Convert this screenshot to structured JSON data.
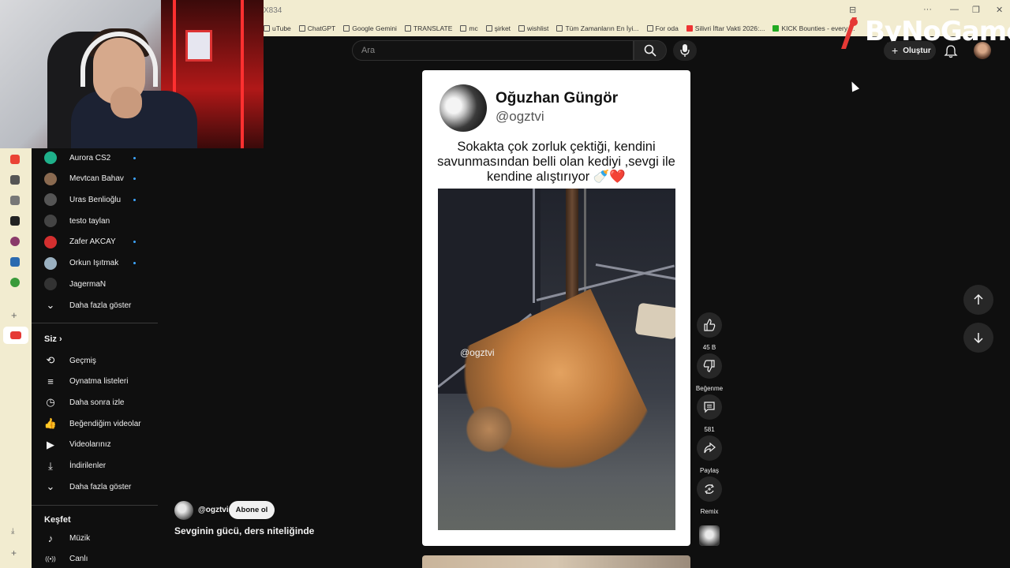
{
  "browser": {
    "tab_title": "X834",
    "bookmarks": [
      {
        "label": "uTube",
        "icon": "youtube-icon"
      },
      {
        "label": "ChatGPT",
        "icon": "chatgpt-icon"
      },
      {
        "label": "Google Gemini",
        "icon": "gemini-icon"
      },
      {
        "label": "TRANSLATE",
        "icon": "translate-icon"
      },
      {
        "label": "mc",
        "icon": "folder-icon"
      },
      {
        "label": "şirket",
        "icon": "folder-icon"
      },
      {
        "label": "wishlist",
        "icon": "folder-icon"
      },
      {
        "label": "Tüm Zamanların En İyi...",
        "icon": "page-icon"
      },
      {
        "label": "For oda",
        "icon": "folder-icon"
      },
      {
        "label": "Silivri İftar Vakti 2026:...",
        "icon": "page-icon"
      },
      {
        "label": "KICK Bounties - every ...",
        "icon": "kick-icon"
      }
    ]
  },
  "overlay": {
    "brand": "ByNoGame"
  },
  "header": {
    "search_placeholder": "Ara",
    "create_label": "Oluştur"
  },
  "sidebar": {
    "subscriptions": [
      {
        "label": "Aurora CS2",
        "new": true,
        "color": "#1fb08a"
      },
      {
        "label": "Mevtcan Bahav",
        "new": true,
        "color": "#8a6a50"
      },
      {
        "label": "Uras Benlioğlu",
        "new": true,
        "color": "#555555"
      },
      {
        "label": "testo taylan",
        "new": false,
        "color": "#444444"
      },
      {
        "label": "Zafer AKCAY",
        "new": true,
        "color": "#d32f2f"
      },
      {
        "label": "Orkun Işıtmak",
        "new": true,
        "color": "#9ab0c0"
      },
      {
        "label": "JagermaN",
        "new": false,
        "color": "#333333"
      }
    ],
    "show_more_1": "Daha fazla göster",
    "you_heading": "Siz",
    "you_items": [
      {
        "label": "Geçmiş",
        "icon": "history-icon"
      },
      {
        "label": "Oynatma listeleri",
        "icon": "playlists-icon"
      },
      {
        "label": "Daha sonra izle",
        "icon": "watch-later-icon"
      },
      {
        "label": "Beğendiğim videolar",
        "icon": "liked-videos-icon"
      },
      {
        "label": "Videolarınız",
        "icon": "your-videos-icon"
      },
      {
        "label": "İndirilenler",
        "icon": "downloads-icon"
      }
    ],
    "show_more_2": "Daha fazla göster",
    "explore_heading": "Keşfet",
    "explore_items": [
      {
        "label": "Müzik",
        "icon": "music-icon"
      },
      {
        "label": "Canlı",
        "icon": "live-icon"
      }
    ]
  },
  "short": {
    "tweet_name": "Oğuzhan Güngör",
    "tweet_handle": "@ogztvi",
    "tweet_text": "Sokakta çok zorluk çektiği, kendini savunmasından belli olan kediyi ,sevgi ile kendine alıştırıyor 🍼❤️",
    "watermark": "@ogztvi",
    "channel": "@ogztvi",
    "subscribe_label": "Abone ol",
    "title": "Sevginin gücü, ders niteliğinde"
  },
  "actions": {
    "like_count": "45 B",
    "dislike_label": "Beğenme",
    "comment_count": "581",
    "share_label": "Paylaş",
    "remix_label": "Remix"
  }
}
